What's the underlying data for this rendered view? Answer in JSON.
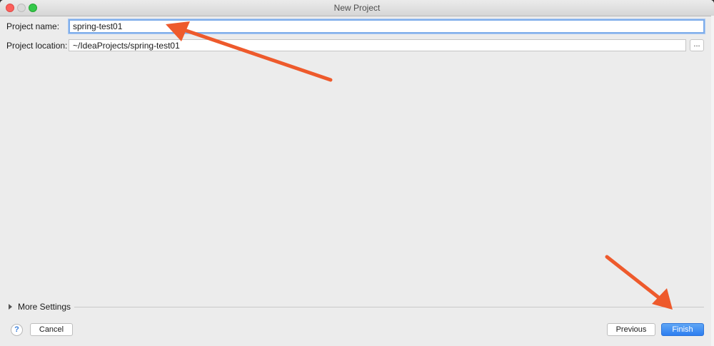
{
  "window": {
    "title": "New Project"
  },
  "form": {
    "project_name_label": "Project name:",
    "project_name_value": "spring-test01",
    "project_location_label": "Project location:",
    "project_location_value": "~/IdeaProjects/spring-test01",
    "browse_label": "..."
  },
  "more_settings": {
    "label": "More Settings"
  },
  "footer": {
    "help_label": "?",
    "cancel_label": "Cancel",
    "previous_label": "Previous",
    "finish_label": "Finish"
  },
  "colors": {
    "annotation_arrow": "#ee5a2c",
    "finish_button": "#3b82f0"
  }
}
